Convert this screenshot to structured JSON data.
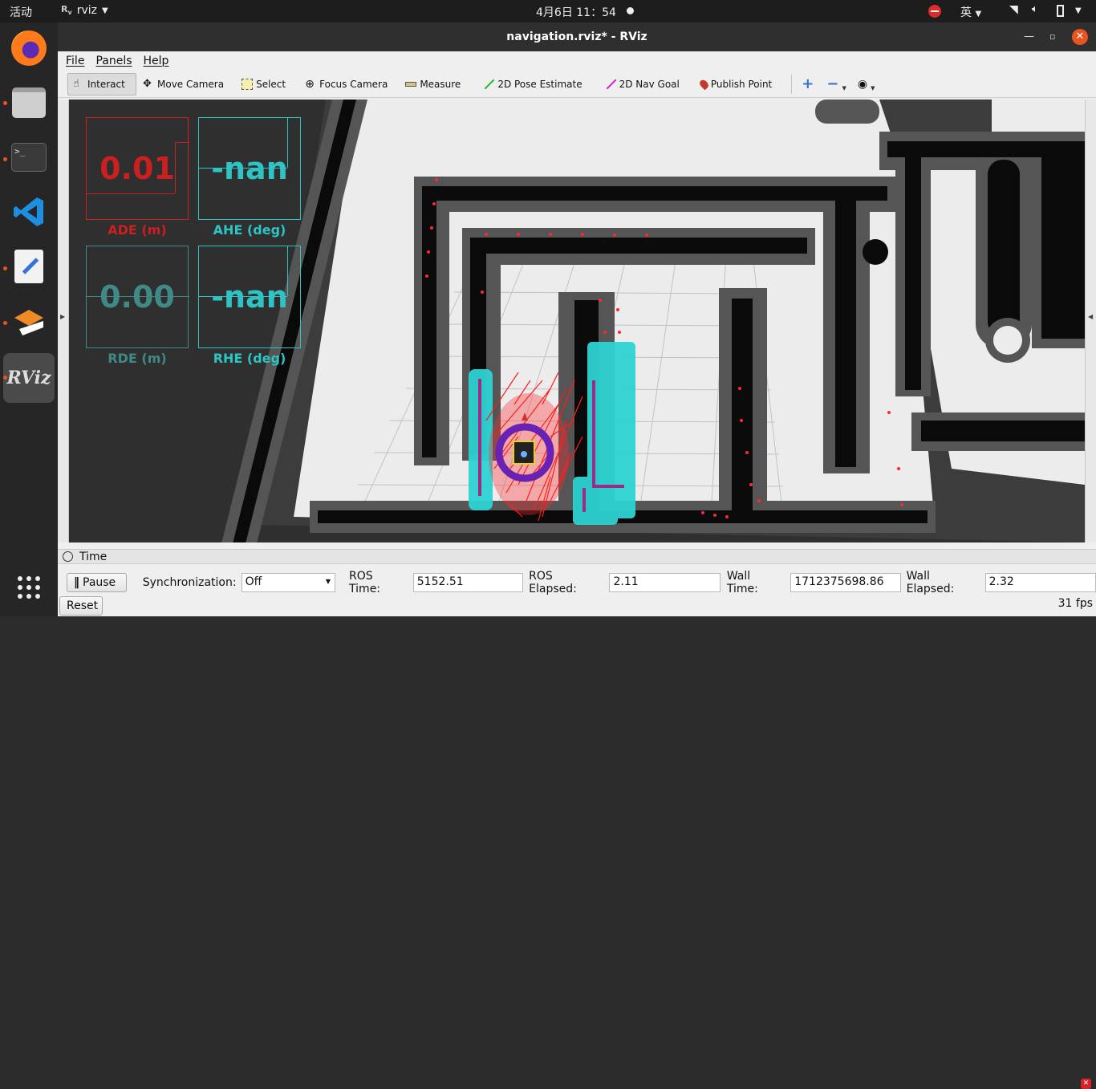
{
  "topbar": {
    "activities": "活动",
    "app_name": "rviz",
    "clock": "4月6日  11：54",
    "ime": "英"
  },
  "window": {
    "title": "navigation.rviz* - RViz"
  },
  "menu": {
    "file": "File",
    "panels": "Panels",
    "help": "Help"
  },
  "toolbar": {
    "interact": "Interact",
    "move_camera": "Move Camera",
    "select": "Select",
    "focus_camera": "Focus Camera",
    "measure": "Measure",
    "pose_estimate": "2D Pose Estimate",
    "nav_goal": "2D Nav Goal",
    "publish_point": "Publish Point"
  },
  "metrics": {
    "ade": {
      "value": "0.01",
      "label": "ADE (m)",
      "color": "#cc1f1f"
    },
    "ahe": {
      "value": "-nan",
      "label": "AHE (deg)",
      "color": "#2ec4c4"
    },
    "rde": {
      "value": "0.00",
      "label": "RDE (m)",
      "color": "#3f8a86"
    },
    "rhe": {
      "value": "-nan",
      "label": "RHE (deg)",
      "color": "#2ec4c4"
    }
  },
  "time_panel": {
    "title": "Time",
    "pause": "Pause",
    "sync_label": "Synchronization:",
    "sync_value": "Off",
    "ros_time_label": "ROS Time:",
    "ros_time": "5152.51",
    "ros_elapsed_label": "ROS Elapsed:",
    "ros_elapsed": "2.11",
    "wall_time_label": "Wall Time:",
    "wall_time": "1712375698.86",
    "wall_elapsed_label": "Wall Elapsed:",
    "wall_elapsed": "2.32",
    "reset": "Reset",
    "fps": "31 fps"
  }
}
